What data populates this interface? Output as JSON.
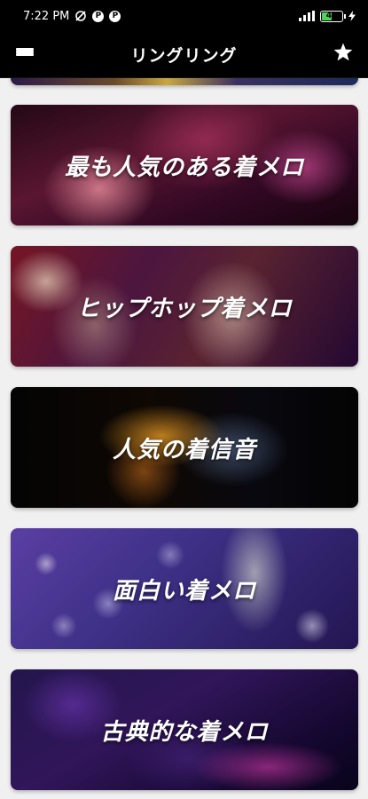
{
  "status_bar": {
    "time": "7:22 PM",
    "icons_left": [
      "sync-off-icon",
      "notification-p-icon",
      "notification-p-icon"
    ],
    "badge_letter": "P",
    "signal_icon": "signal-bars-icon",
    "battery_level": "45",
    "charging_icon": "lightning-icon"
  },
  "app_bar": {
    "title": "リングリング",
    "menu_icon": "hamburger-icon",
    "favorite_icon": "star-icon"
  },
  "categories": [
    {
      "label": "最も人気のある着メロ"
    },
    {
      "label": "ヒップホップ着メロ"
    },
    {
      "label": "人気の着信音"
    },
    {
      "label": "面白い着メロ"
    },
    {
      "label": "古典的な着メロ"
    }
  ],
  "colors": {
    "app_bar_bg": "#000000",
    "content_bg": "#f0f0f0",
    "battery_fill": "#4bd35a"
  }
}
